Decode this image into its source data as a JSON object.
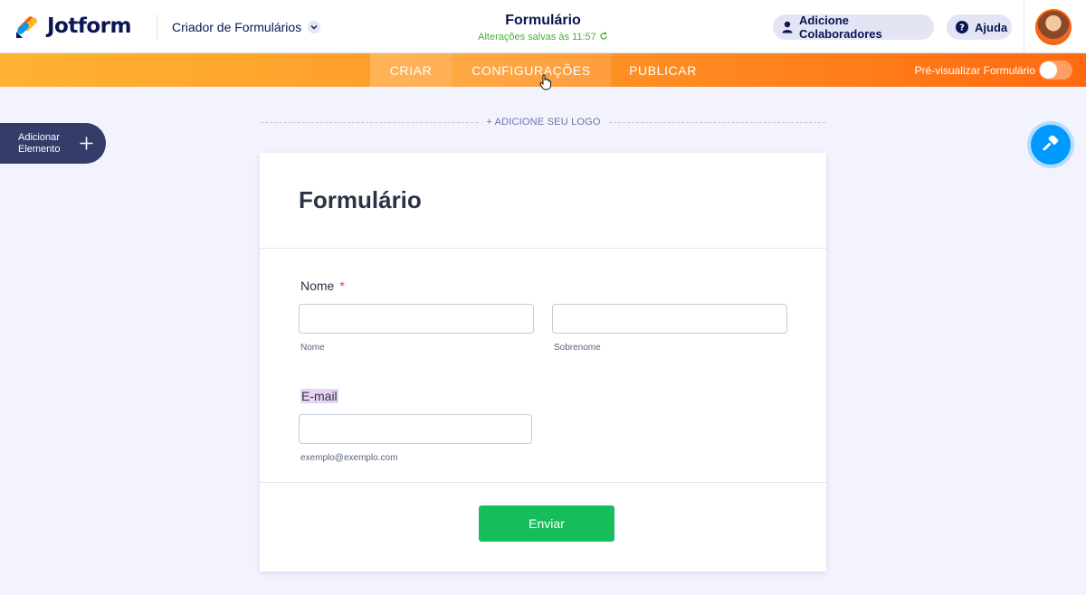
{
  "header": {
    "brand": "Jotform",
    "builder_label": "Criador de Formulários",
    "form_title": "Formulário",
    "saved_status": "Alterações salvas às 11:57",
    "collaborators_label": "Adicione Colaboradores",
    "help_label": "Ajuda"
  },
  "nav": {
    "tabs": [
      {
        "label": "CRIAR",
        "active": true
      },
      {
        "label": "CONFIGURAÇÕES",
        "hovered": true
      },
      {
        "label": "PUBLICAR"
      }
    ],
    "preview_label": "Pré-visualizar Formulário",
    "preview_enabled": false
  },
  "sidebar": {
    "add_element_line1": "Adicionar",
    "add_element_line2": "Elemento"
  },
  "logo_placeholder": "+ ADICIONE SEU LOGO",
  "form": {
    "title": "Formulário",
    "fields": [
      {
        "label": "Nome",
        "required_mark": "*",
        "sublabels": [
          "Nome",
          "Sobrenome"
        ],
        "values": [
          "",
          ""
        ]
      },
      {
        "label": "E-mail",
        "sublabel": "exemplo@exemplo.com",
        "value": ""
      }
    ],
    "submit_label": "Enviar"
  },
  "colors": {
    "brand_navy": "#0a1551",
    "nav_gradient_start": "#ffb233",
    "nav_gradient_end": "#ff6a10",
    "submit_green": "#18bd5b",
    "designer_blue": "#0099ff",
    "saved_green": "#4dae3a",
    "required_red": "#f23a3c"
  },
  "icons": {
    "logo": "jotform-logo-icon",
    "builder_dropdown": "chevron-down-icon",
    "saved": "refresh-icon",
    "collaborators": "user-icon",
    "help": "question-icon",
    "add_element": "plus-icon",
    "designer": "paint-roller-icon",
    "cursor": "hand-pointer-icon"
  }
}
